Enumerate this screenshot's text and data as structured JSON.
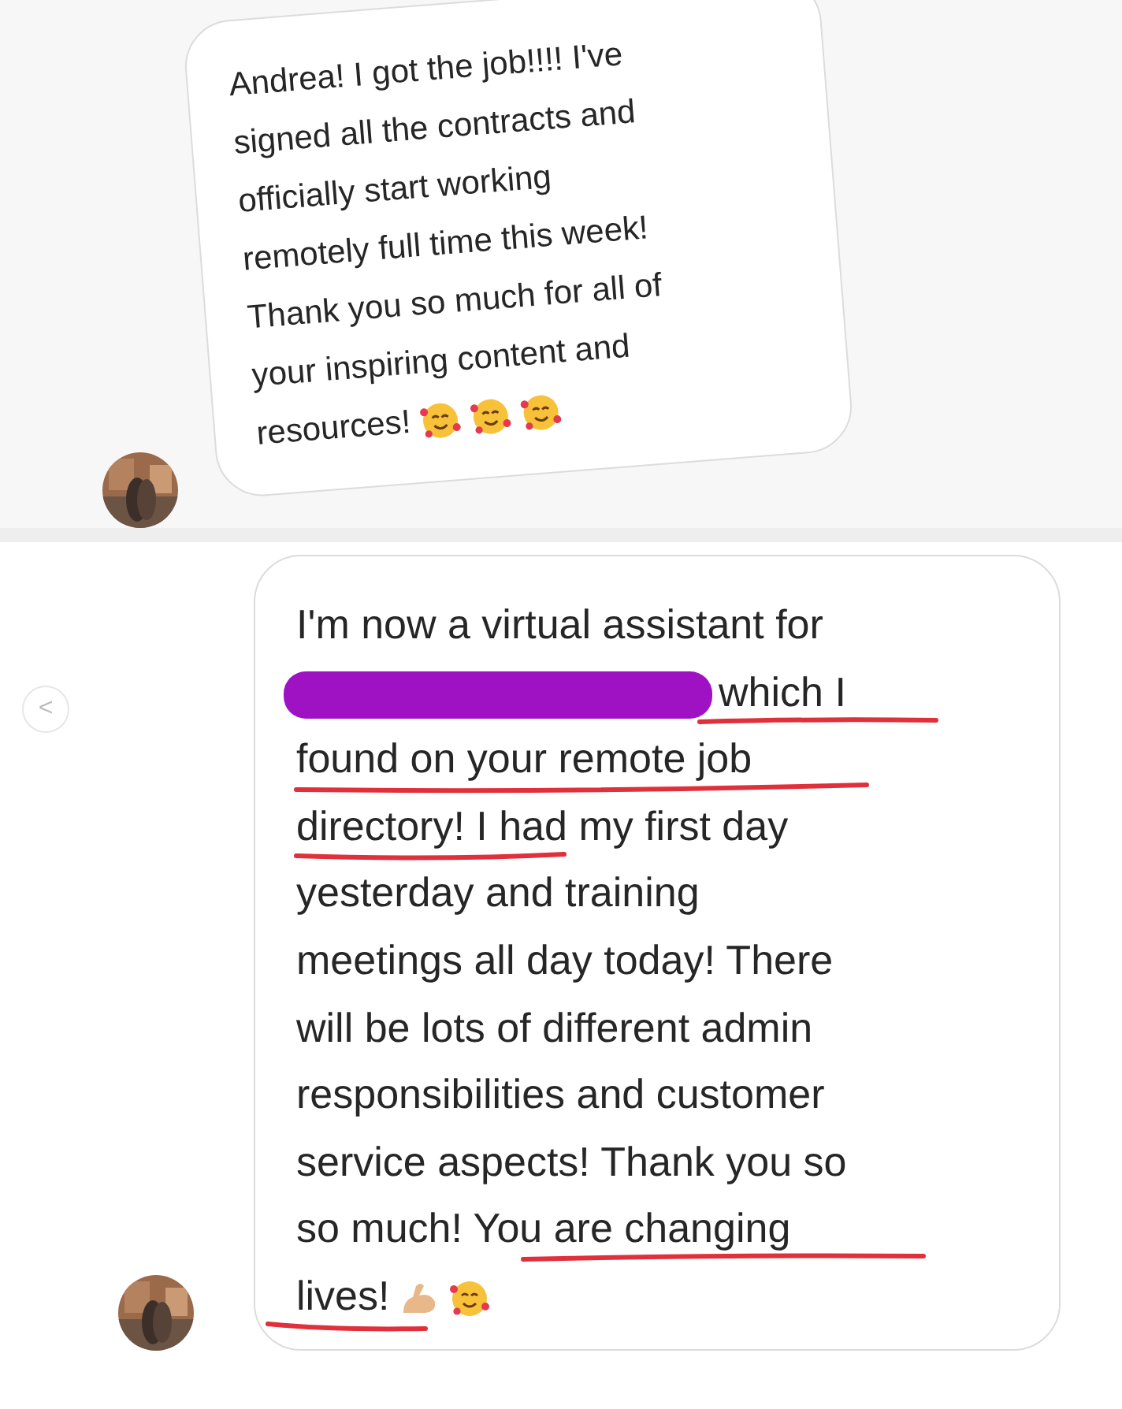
{
  "messages": [
    {
      "lines": [
        {
          "text": "Andrea! I got the job!!!! I've",
          "redacted": false
        },
        {
          "text": "signed all the contracts and",
          "redacted": false
        },
        {
          "text": "officially start working",
          "redacted": false
        },
        {
          "text": "remotely full time this week!",
          "redacted": false
        },
        {
          "text": "Thank you so much for all of",
          "redacted": false
        },
        {
          "text": "your inspiring content and",
          "redacted": false
        },
        {
          "text": "resources!",
          "redacted": false
        }
      ],
      "emojis": [
        {
          "kind": "hearts-face"
        },
        {
          "kind": "hearts-face"
        },
        {
          "kind": "hearts-face"
        }
      ],
      "tilted": true
    },
    {
      "lines": [
        {
          "text": "I'm now a virtual assistant for",
          "redacted": false
        },
        {
          "text": "which I",
          "redacted": true
        },
        {
          "text": "found on your remote job",
          "redacted": false
        },
        {
          "text": "directory! I had my first day",
          "redacted": false
        },
        {
          "text": "yesterday and training",
          "redacted": false
        },
        {
          "text": "meetings all day today! There",
          "redacted": false
        },
        {
          "text": "will be lots of different admin",
          "redacted": false
        },
        {
          "text": "responsibilities and customer",
          "redacted": false
        },
        {
          "text": "service aspects! Thank you so",
          "redacted": false
        },
        {
          "text": "so much! You are changing",
          "redacted": false
        },
        {
          "text": "lives!",
          "redacted": false
        }
      ],
      "emojis": [
        {
          "kind": "flexed-arm"
        },
        {
          "kind": "hearts-face"
        }
      ],
      "tilted": false
    }
  ],
  "nav": {
    "back": "<"
  }
}
